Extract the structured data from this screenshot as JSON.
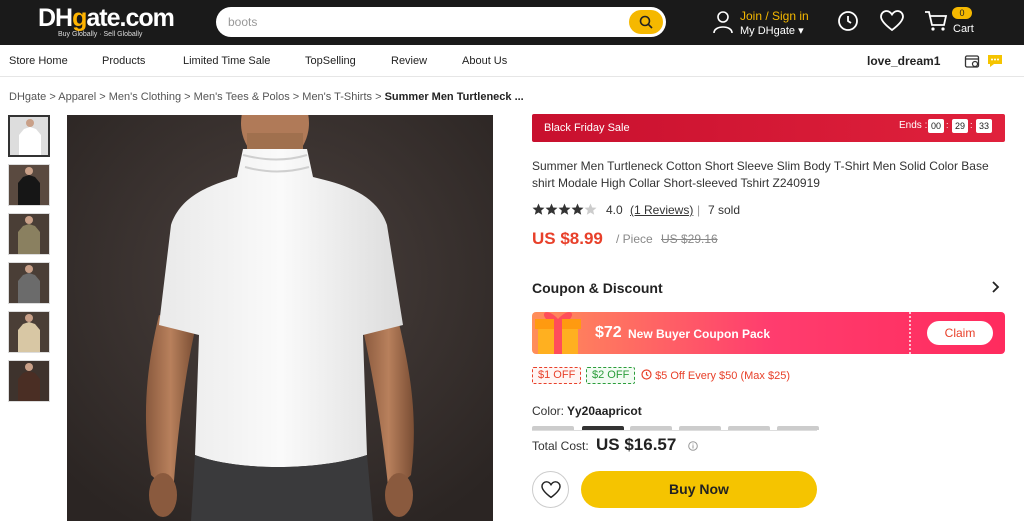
{
  "header": {
    "logo_main": "DHgate.com",
    "logo_tagline": "Buy Globally · Sell Globally",
    "search_placeholder": "boots",
    "join_label": "Join / Sign in",
    "my_account_label": "My DHgate",
    "cart_count": "0",
    "cart_label": "Cart",
    "accent_color": "#f5b800"
  },
  "nav": {
    "items": [
      "Store Home",
      "Products",
      "Limited Time Sale",
      "TopSelling",
      "Review",
      "About Us"
    ],
    "store_name": "love_dream1"
  },
  "breadcrumb": {
    "items": [
      "DHgate",
      "Apparel",
      "Men's Clothing",
      "Men's Tees & Polos",
      "Men's T-Shirts"
    ],
    "current": "Summer Men Turtleneck ...",
    "separator": ">"
  },
  "gallery": {
    "thumb_colors": [
      "white",
      "black",
      "olive",
      "gray",
      "beige",
      "brown"
    ]
  },
  "product": {
    "sale_label": "Black Friday Sale",
    "ends_label": "Ends :",
    "timer": [
      "00",
      "29",
      "33"
    ],
    "title": "Summer Men Turtleneck Cotton Short Sleeve Slim Body T-Shirt Men Solid Color Base shirt Modale High Collar Short-sleeved Tshirt Z240919",
    "rating": "4.0",
    "rating_value": 4.0,
    "reviews": "(1 Reviews)",
    "sold": "7 sold",
    "price": "US $8.99",
    "per_unit": "/ Piece",
    "original_price": "US $29.16"
  },
  "coupon": {
    "title": "Coupon & Discount",
    "amount": "$72",
    "pack_text": "New Buyer Coupon Pack",
    "claim_label": "Claim",
    "tags": [
      "$1 OFF",
      "$2 OFF"
    ],
    "promo": "$5 Off Every $50  (Max $25)"
  },
  "variant": {
    "color_label": "Color:",
    "color_value": "Yy20aapricot"
  },
  "purchase": {
    "total_label": "Total Cost:",
    "total_value": "US $16.57",
    "buy_label": "Buy Now"
  }
}
